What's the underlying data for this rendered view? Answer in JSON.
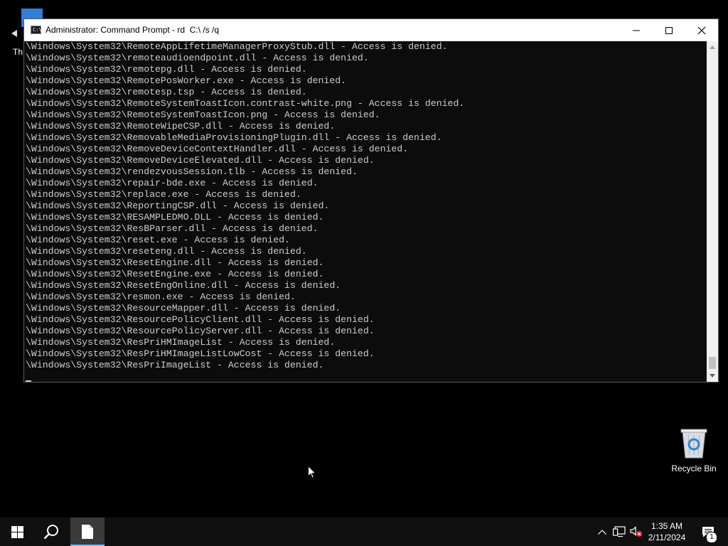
{
  "desktop": {
    "partial_icon_label": "Th",
    "recycle_bin_label": "Recycle Bin"
  },
  "window": {
    "title": "Administrator: Command Prompt - rd  C:\\ /s /q",
    "app_icon_text": "C:\\",
    "controls": [
      "minimize",
      "maximize",
      "close"
    ]
  },
  "console": {
    "lines": [
      "\\Windows\\System32\\RemoteAppLifetimeManagerProxyStub.dll - Access is denied.",
      "\\Windows\\System32\\remoteaudioendpoint.dll - Access is denied.",
      "\\Windows\\System32\\remotepg.dll - Access is denied.",
      "\\Windows\\System32\\RemotePosWorker.exe - Access is denied.",
      "\\Windows\\System32\\remotesp.tsp - Access is denied.",
      "\\Windows\\System32\\RemoteSystemToastIcon.contrast-white.png - Access is denied.",
      "\\Windows\\System32\\RemoteSystemToastIcon.png - Access is denied.",
      "\\Windows\\System32\\RemoteWipeCSP.dll - Access is denied.",
      "\\Windows\\System32\\RemovableMediaProvisioningPlugin.dll - Access is denied.",
      "\\Windows\\System32\\RemoveDeviceContextHandler.dll - Access is denied.",
      "\\Windows\\System32\\RemoveDeviceElevated.dll - Access is denied.",
      "\\Windows\\System32\\rendezvousSession.tlb - Access is denied.",
      "\\Windows\\System32\\repair-bde.exe - Access is denied.",
      "\\Windows\\System32\\replace.exe - Access is denied.",
      "\\Windows\\System32\\ReportingCSP.dll - Access is denied.",
      "\\Windows\\System32\\RESAMPLEDMO.DLL - Access is denied.",
      "\\Windows\\System32\\ResBParser.dll - Access is denied.",
      "\\Windows\\System32\\reset.exe - Access is denied.",
      "\\Windows\\System32\\reseteng.dll - Access is denied.",
      "\\Windows\\System32\\ResetEngine.dll - Access is denied.",
      "\\Windows\\System32\\ResetEngine.exe - Access is denied.",
      "\\Windows\\System32\\ResetEngOnline.dll - Access is denied.",
      "\\Windows\\System32\\resmon.exe - Access is denied.",
      "\\Windows\\System32\\ResourceMapper.dll - Access is denied.",
      "\\Windows\\System32\\ResourcePolicyClient.dll - Access is denied.",
      "\\Windows\\System32\\ResourcePolicyServer.dll - Access is denied.",
      "\\Windows\\System32\\ResPriHMImageList - Access is denied.",
      "\\Windows\\System32\\ResPriHMImageListLowCost - Access is denied.",
      "\\Windows\\System32\\ResPriImageList - Access is denied."
    ]
  },
  "taskbar": {
    "time": "1:35 AM",
    "date": "2/11/2024",
    "notification_count": "1",
    "icons": {
      "start": "windows-logo-icon",
      "search": "search-icon",
      "app": "command-prompt-icon",
      "chevron": "chevron-up-icon",
      "network": "network-icon",
      "volume": "volume-muted-icon",
      "notifications": "action-center-icon"
    }
  },
  "colors": {
    "console_bg": "#0c0c0c",
    "console_text": "#cccccc",
    "taskbar_bg": "#101010",
    "accent": "#76b9ed",
    "muted_x": "#e81123"
  }
}
